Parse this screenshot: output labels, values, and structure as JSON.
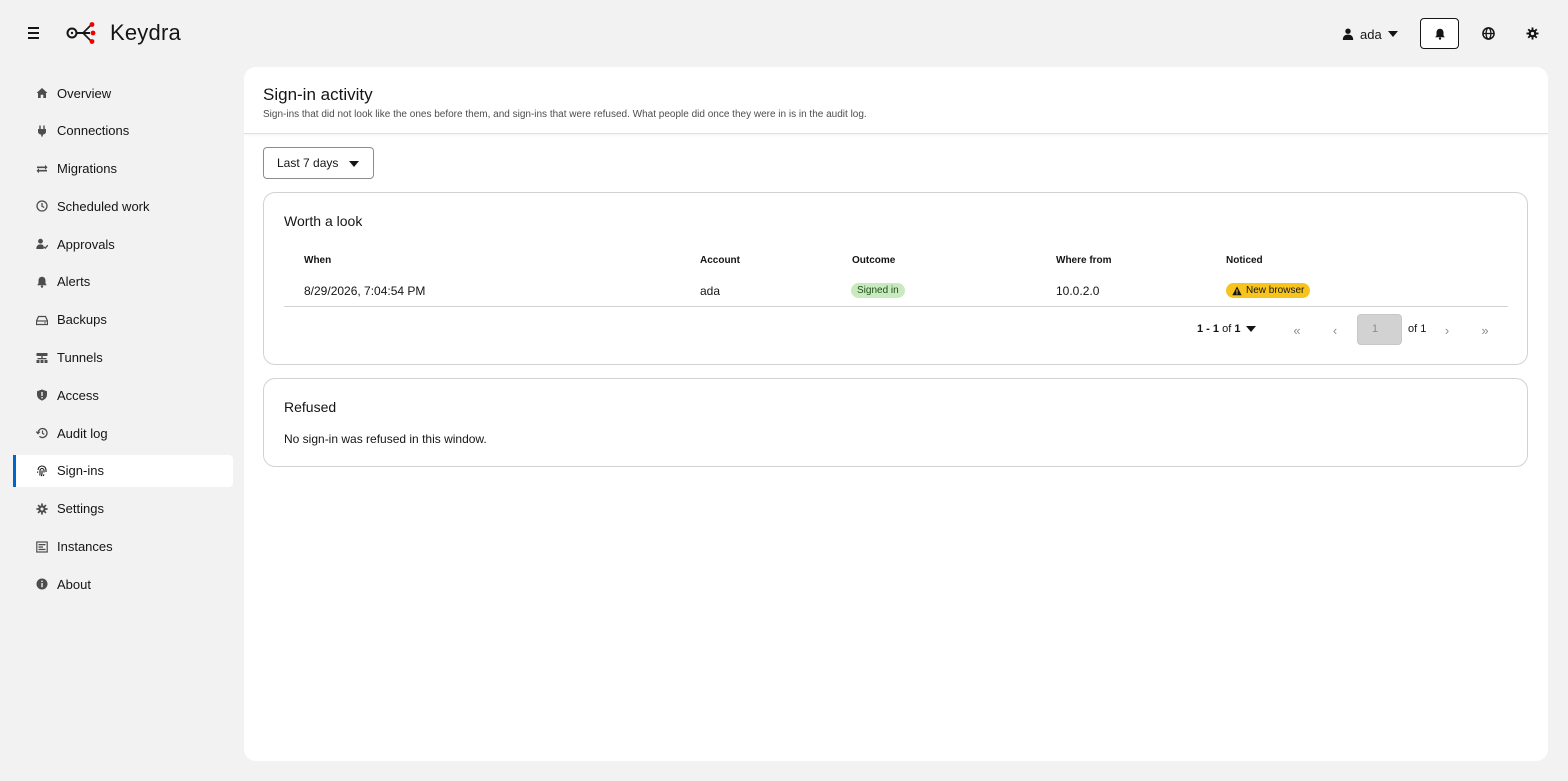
{
  "header": {
    "app_name": "Keydra",
    "user": "ada",
    "icons": [
      "hamburger-icon",
      "keydra-logo",
      "user-icon",
      "bell-icon",
      "globe-icon",
      "gear-icon"
    ]
  },
  "sidebar": {
    "items": [
      {
        "label": "Overview",
        "icon": "home-icon"
      },
      {
        "label": "Connections",
        "icon": "plug-icon"
      },
      {
        "label": "Migrations",
        "icon": "arrows-exchange-icon"
      },
      {
        "label": "Scheduled work",
        "icon": "clock-icon"
      },
      {
        "label": "Approvals",
        "icon": "user-check-icon"
      },
      {
        "label": "Alerts",
        "icon": "bell-icon"
      },
      {
        "label": "Backups",
        "icon": "drive-icon"
      },
      {
        "label": "Tunnels",
        "icon": "network-icon"
      },
      {
        "label": "Access",
        "icon": "shield-icon"
      },
      {
        "label": "Audit log",
        "icon": "history-icon"
      },
      {
        "label": "Sign-ins",
        "icon": "fingerprint-icon",
        "active": true
      },
      {
        "label": "Settings",
        "icon": "gear-icon"
      },
      {
        "label": "Instances",
        "icon": "server-icon"
      },
      {
        "label": "About",
        "icon": "info-icon"
      }
    ],
    "active_color": "#0066cc"
  },
  "page": {
    "title": "Sign-in activity",
    "subtitle": "Sign-ins that did not look like the ones before them, and sign-ins that were refused. What people did once they were in is in the audit log.",
    "range_selected": "Last 7 days"
  },
  "worth_a_look": {
    "title": "Worth a look",
    "columns": [
      "When",
      "Account",
      "Outcome",
      "Where from",
      "Noticed"
    ],
    "rows": [
      {
        "when": "8/29/2026, 7:04:54 PM",
        "account": "ada",
        "outcome": "Signed in",
        "where_from": "10.0.2.0",
        "noticed": "New browser"
      }
    ],
    "pager": {
      "range": "1 - 1",
      "of_label": "of",
      "total": "1",
      "current_page": "1",
      "of_pages": "of 1"
    }
  },
  "refused": {
    "title": "Refused",
    "empty_text": "No sign-in was refused in this window."
  },
  "colors": {
    "badge_green_bg": "#c9e9bf",
    "badge_warn_bg": "#f6c41c"
  }
}
